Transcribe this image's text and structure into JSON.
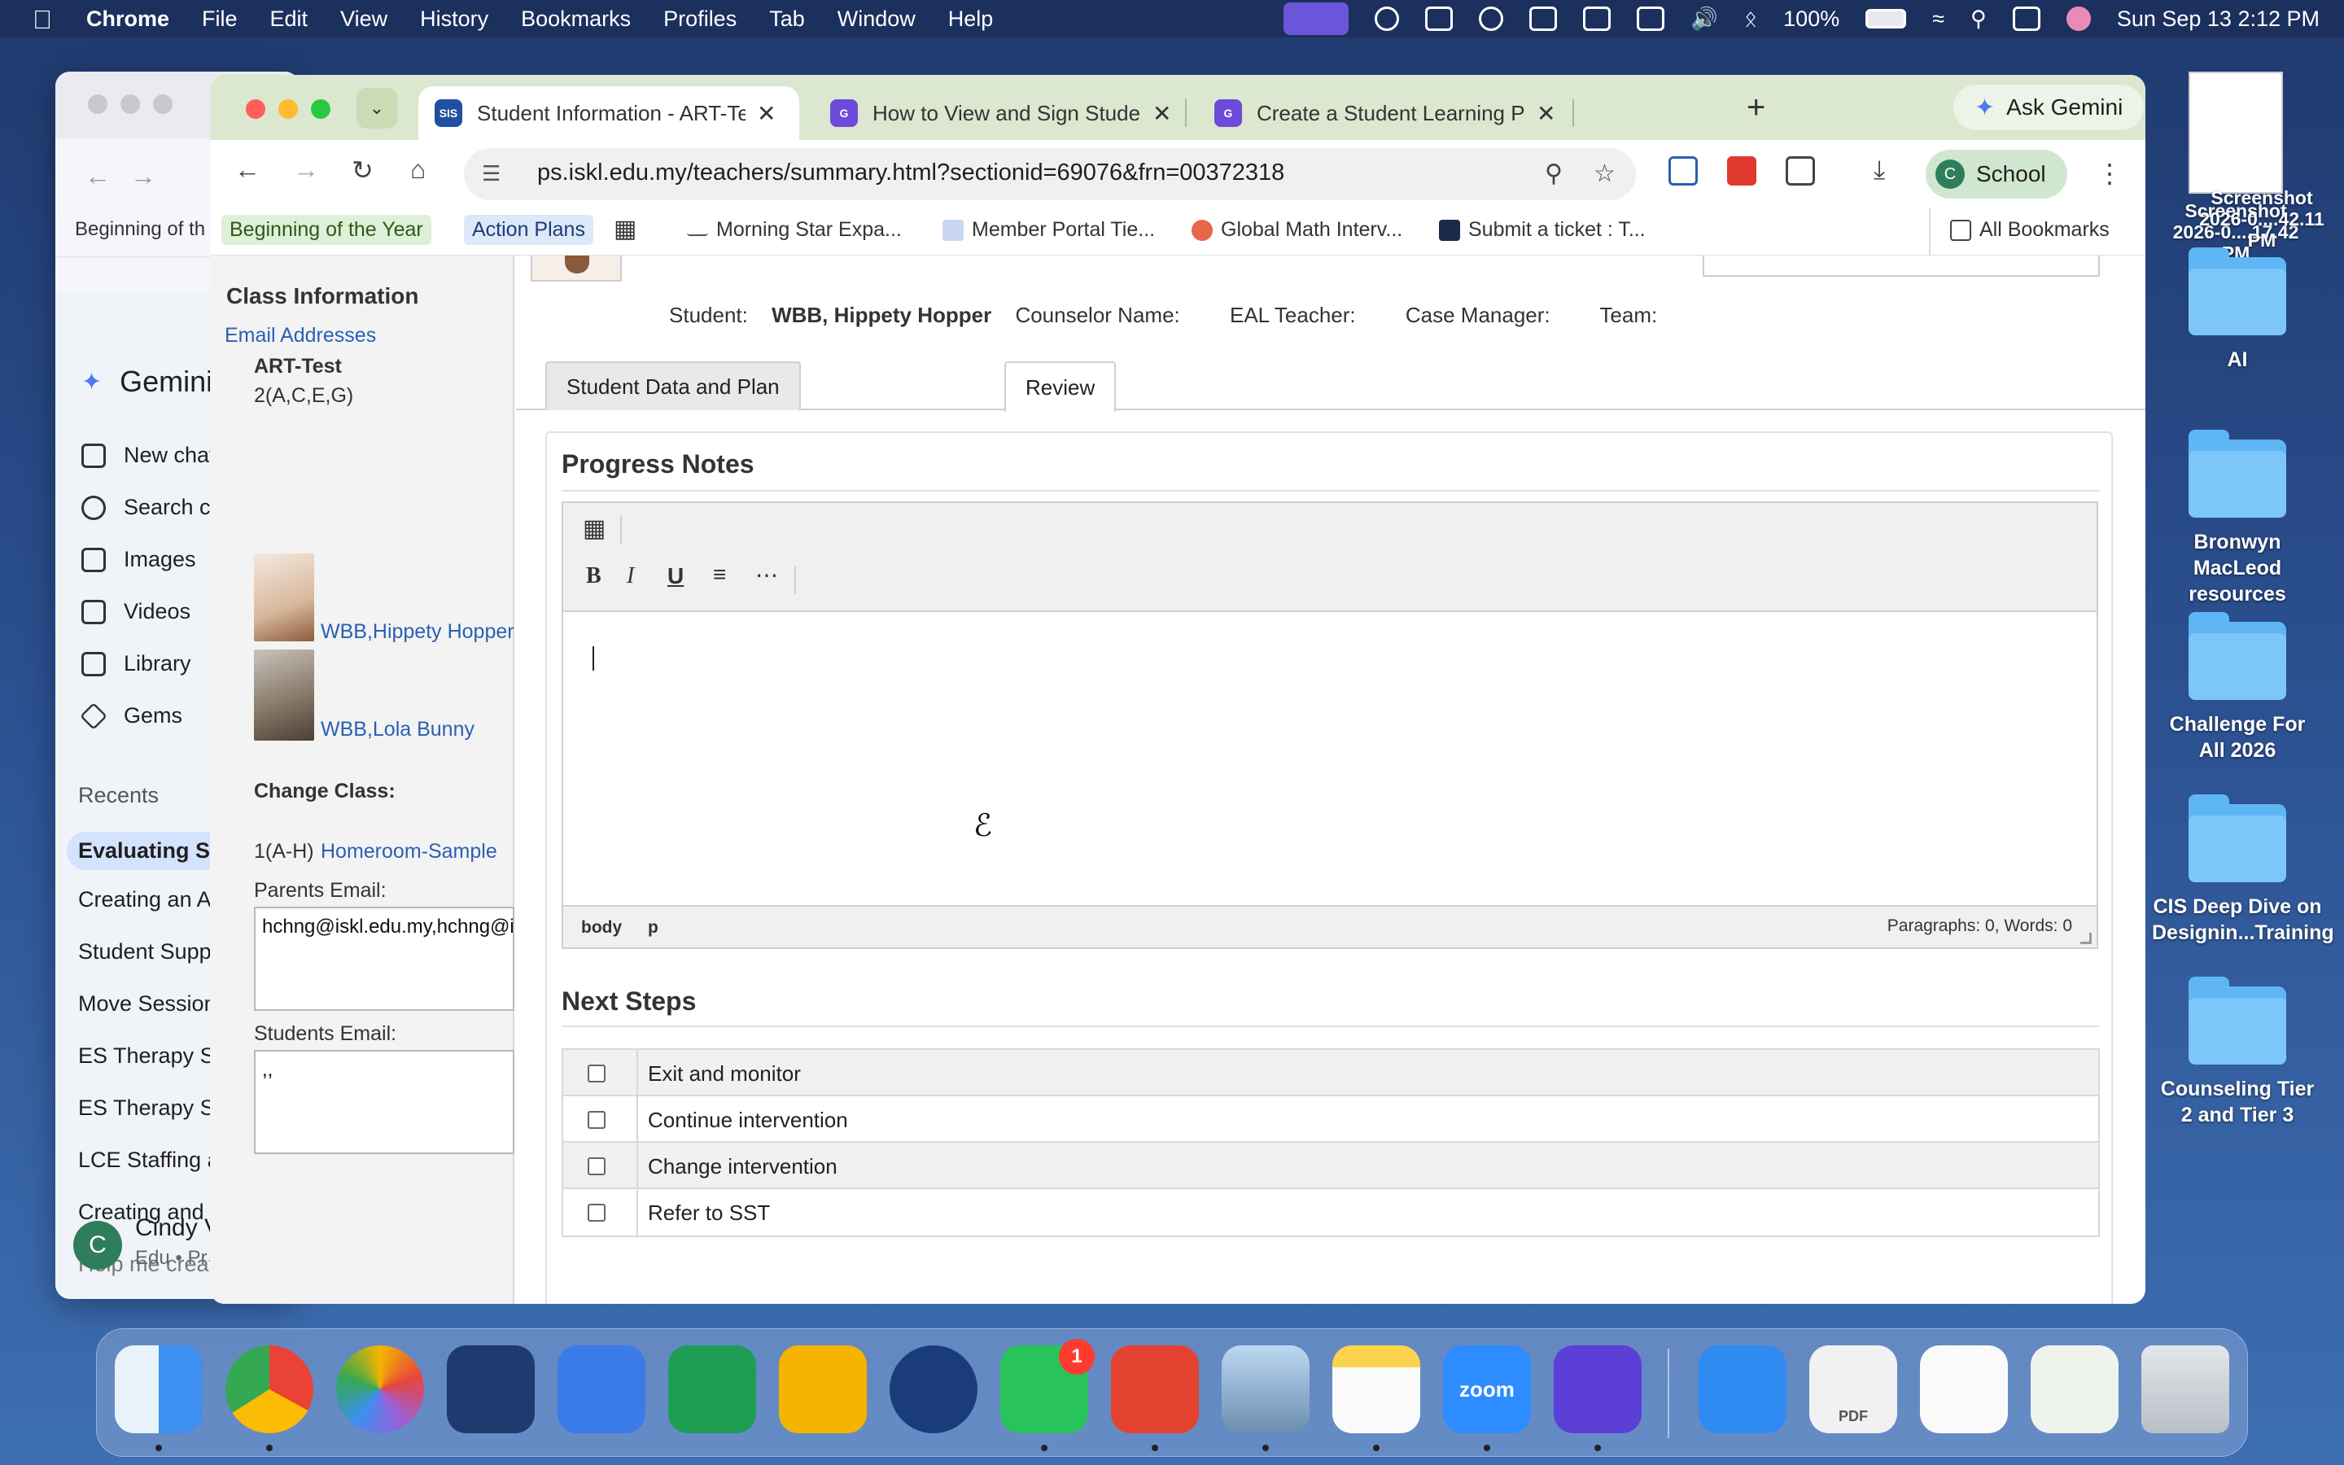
{
  "menubar": {
    "app": "Chrome",
    "items": [
      "File",
      "Edit",
      "View",
      "History",
      "Bookmarks",
      "Profiles",
      "Tab",
      "Window",
      "Help"
    ],
    "battery": "100%",
    "datetime": "Sun Sep 13  2:12 PM"
  },
  "bg_window": {
    "bookmark": "Beginning of th",
    "gemini_title": "Gemini",
    "nav": [
      "New chat",
      "Search c",
      "Images",
      "Videos",
      "Library",
      "Gems"
    ],
    "recents_label": "Recents",
    "recents": [
      "Evaluating St",
      "Creating an A",
      "Student Supp",
      "Move Session",
      "ES Therapy Sc",
      "ES Therapy Sc",
      "LCE Staffing a",
      "Creating and",
      "Help me creat"
    ],
    "user_initial": "C",
    "user_name": "Cindy V",
    "user_sub": "Edu • Pr"
  },
  "chrome": {
    "tabs": [
      {
        "title": "Student Information - ART-Test",
        "favicon": "SIS",
        "active": true
      },
      {
        "title": "How to View and Sign Student",
        "favicon": "G",
        "active": false
      },
      {
        "title": "Create a Student Learning Plan",
        "favicon": "G",
        "active": false
      }
    ],
    "ask_gemini": "Ask Gemini",
    "url": "ps.iskl.edu.my/teachers/summary.html?sectionid=69076&frn=00372318",
    "profile_initial": "C",
    "profile_name": "School",
    "bookmarks": [
      "Beginning of the Year",
      "Action Plans",
      "Morning Star Expa...",
      "Member Portal Tie...",
      "Global Math Interv...",
      "Submit a ticket : T..."
    ],
    "all_bookmarks": "All Bookmarks"
  },
  "left_panel": {
    "title": "Class Information",
    "email_link": "Email Addresses",
    "class_name": "ART-Test",
    "class_period": "2(A,C,E,G)",
    "students": [
      {
        "name": "WBB,Hippety Hopper"
      },
      {
        "name": "WBB,Lola Bunny"
      }
    ],
    "change_class_label": "Change Class:",
    "change_class_period": "1(A-H)",
    "change_class_link": "Homeroom-Sample",
    "parents_email_label": "Parents Email:",
    "parents_email_value": "hchng@iskl.edu.my,hchng@iskl.edu.my,,",
    "students_email_label": "Students Email:",
    "students_email_value": ",,"
  },
  "student_info": {
    "student_label": "Student:",
    "student_value": "WBB, Hippety Hopper",
    "counselor_label": "Counselor Name:",
    "eal_label": "EAL Teacher:",
    "case_manager_label": "Case Manager:",
    "team_label": "Team:"
  },
  "page_tabs": [
    "Student Data and Plan",
    "Review"
  ],
  "progress_notes": {
    "title": "Progress Notes",
    "path": [
      "body",
      "p"
    ],
    "counts": "Paragraphs: 0, Words: 0"
  },
  "next_steps": {
    "title": "Next Steps",
    "options": [
      "Exit and monitor",
      "Continue intervention",
      "Change intervention",
      "Refer to SST"
    ]
  },
  "desktop": {
    "screenshots": [
      "Screenshot 2026-0....17.42 PM",
      "Screenshot 2026-0....42.11 PM"
    ],
    "folders": [
      "AI",
      "Bronwyn MacLeod resources",
      "Challenge For All 2026",
      "CIS Deep Dive on Designin...Training",
      "Counseling Tier 2 and Tier 3"
    ]
  },
  "dock": {
    "apps": [
      "Finder",
      "Chrome",
      "Photos",
      "Keynote",
      "Docs",
      "Sheets",
      "Slides",
      "School App",
      "WhatsApp",
      "Todoist",
      "Preview",
      "Notes",
      "Zoom",
      "Grammarly",
      "App Store",
      "PDF",
      "Document",
      "Screenshot",
      "Trash"
    ],
    "zoom_label": "zoom",
    "pdf_label": "PDF",
    "whatsapp_badge": "1"
  }
}
